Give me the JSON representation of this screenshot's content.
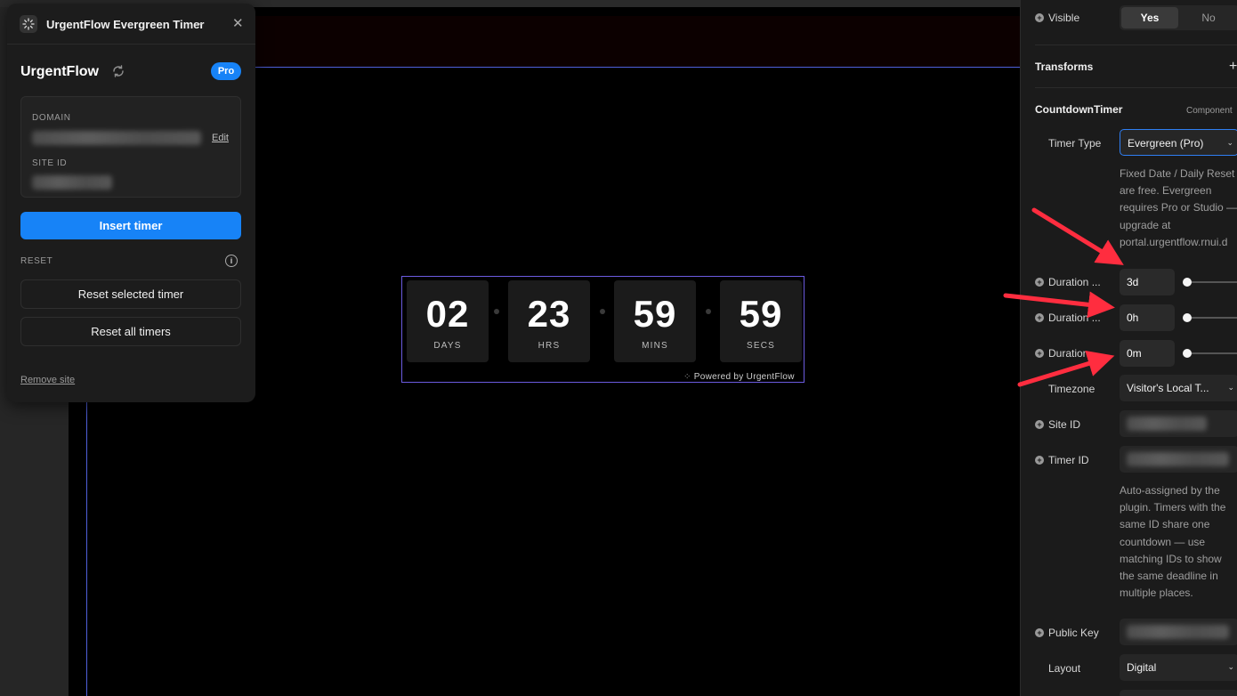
{
  "plugin": {
    "title": "UrgentFlow Evergreen Timer",
    "close_glyph": "✕",
    "chevron_glyph": "⌄",
    "brand": "UrgentFlow",
    "badge": "Pro",
    "domain_label": "DOMAIN",
    "edit_label": "Edit",
    "site_id_label": "SITE ID",
    "insert_button": "Insert timer",
    "reset_label": "RESET",
    "info_glyph": "i",
    "reset_selected": "Reset selected timer",
    "reset_all": "Reset all timers",
    "remove_site": "Remove site"
  },
  "timer": {
    "units": [
      {
        "value": "02",
        "caption": "DAYS"
      },
      {
        "value": "23",
        "caption": "HRS"
      },
      {
        "value": "59",
        "caption": "MINS"
      },
      {
        "value": "59",
        "caption": "SECS"
      }
    ],
    "powered_by": "Powered by UrgentFlow"
  },
  "props": {
    "visible_label": "Visible",
    "visible_yes": "Yes",
    "visible_no": "No",
    "transforms_title": "Transforms",
    "plus_glyph": "+",
    "component_title": "CountdownTimer",
    "component_tag": "Component",
    "timer_type_label": "Timer Type",
    "timer_type_value": "Evergreen (Pro)",
    "timer_type_help": "Fixed Date / Daily Reset are free. Evergreen requires Pro or Studio — upgrade at portal.urgentflow.rnui.d",
    "duration_days_label": "Duration ...",
    "duration_days_value": "3d",
    "duration_hours_label": "Duration ...",
    "duration_hours_value": "0h",
    "duration_mins_label": "Duration ...",
    "duration_mins_value": "0m",
    "timezone_label": "Timezone",
    "timezone_value": "Visitor's Local T...",
    "site_id_label": "Site ID",
    "timer_id_label": "Timer ID",
    "timer_id_help": "Auto-assigned by the plugin. Timers with the same ID share one countdown — use matching IDs to show the same deadline in multiple places.",
    "public_key_label": "Public Key",
    "layout_label": "Layout",
    "layout_value": "Digital",
    "select_chevron": "⌄"
  },
  "colors": {
    "accent": "#1783f7",
    "selection": "#6b5be0",
    "annotation": "#ff2d3f"
  }
}
